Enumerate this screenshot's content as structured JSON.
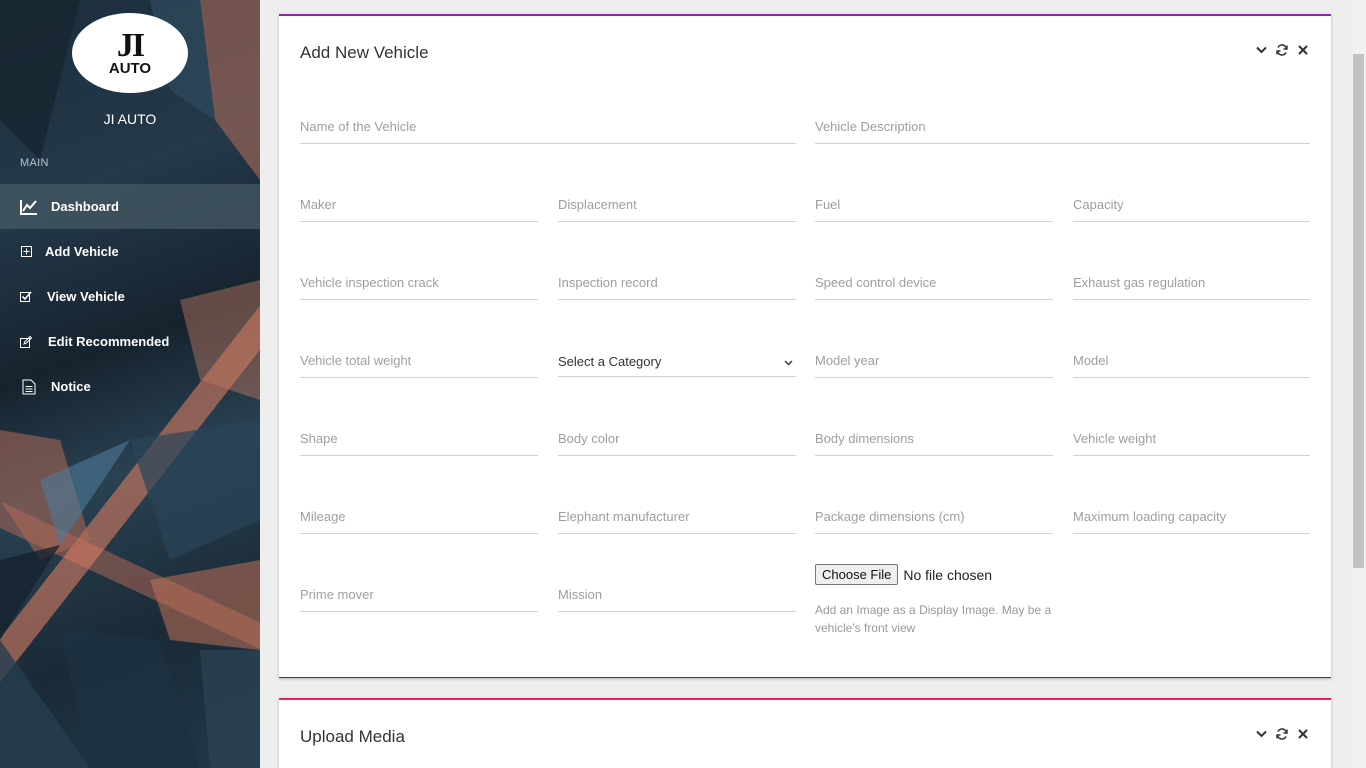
{
  "brand": {
    "logo_mark": "JI",
    "logo_word": "AUTO",
    "name": "JI AUTO"
  },
  "sidebar": {
    "section_label": "MAIN",
    "items": [
      {
        "label": "Dashboard",
        "icon": "chart-line-icon",
        "active": true
      },
      {
        "label": "Add Vehicle",
        "icon": "plus-square-icon"
      },
      {
        "label": "View Vehicle",
        "icon": "check-square-icon"
      },
      {
        "label": "Edit Recommended",
        "icon": "edit-icon"
      },
      {
        "label": "Notice",
        "icon": "document-icon"
      }
    ]
  },
  "form_card": {
    "title": "Add New Vehicle",
    "fields": {
      "name": "Name of the Vehicle",
      "description": "Vehicle Description",
      "maker": "Maker",
      "displacement": "Displacement",
      "fuel": "Fuel",
      "capacity": "Capacity",
      "inspection_crack": "Vehicle inspection crack",
      "inspection_record": "Inspection record",
      "speed_control": "Speed control device",
      "exhaust": "Exhaust gas regulation",
      "total_weight": "Vehicle total weight",
      "model_year": "Model year",
      "model": "Model",
      "shape": "Shape",
      "body_color": "Body color",
      "body_dimensions": "Body dimensions",
      "vehicle_weight": "Vehicle weight",
      "mileage": "Mileage",
      "elephant_manufacturer": "Elephant manufacturer",
      "package_dimensions": "Package dimensions (cm)",
      "max_loading": "Maximum loading capacity",
      "prime_mover": "Prime mover",
      "mission": "Mission"
    },
    "category_select": "Select a Category",
    "file": {
      "button": "Choose File",
      "status": "No file chosen",
      "help": "Add an Image as a Display Image. May be a vehicle's front view"
    }
  },
  "media_card": {
    "title": "Upload Media"
  },
  "colors": {
    "form_accent": "#8e24aa",
    "media_accent": "#e91e63"
  }
}
